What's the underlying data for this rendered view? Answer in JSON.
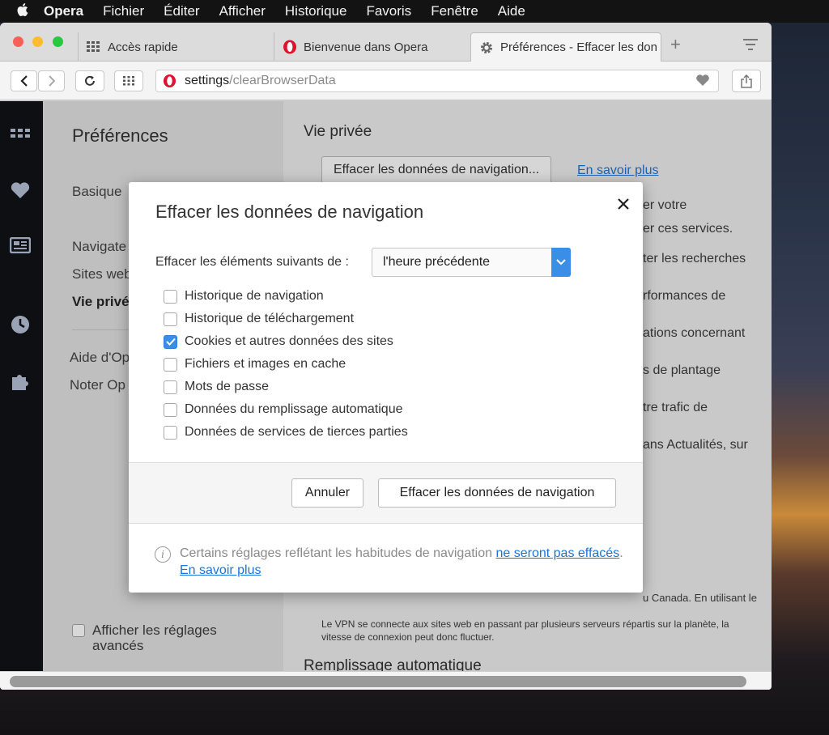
{
  "menubar": {
    "apple": "",
    "app": "Opera",
    "items": [
      "Fichier",
      "Éditer",
      "Afficher",
      "Historique",
      "Favoris",
      "Fenêtre",
      "Aide"
    ]
  },
  "tabs": [
    {
      "label": "Accès rapide",
      "icon": "speed-dial-icon"
    },
    {
      "label": "Bienvenue dans Opera",
      "icon": "opera-logo-icon"
    },
    {
      "label": "Préférences - Effacer les don",
      "icon": "gear-icon",
      "active": true
    }
  ],
  "newtab": "+",
  "address": {
    "host": "settings",
    "path": "/clearBrowserData"
  },
  "prefs": {
    "title": "Préférences",
    "nav": [
      "Basique",
      "Navigate",
      "Sites web",
      "Vie privé",
      "Aide d'Op",
      "Noter Op"
    ],
    "advanced": "Afficher les réglages avancés"
  },
  "content": {
    "heading": "Vie privée",
    "clear_button": "Effacer les données de navigation...",
    "learn_more": "En savoir plus",
    "fragments": [
      "er votre",
      "er ces services.",
      "ter les recherches",
      "rformances de",
      "ations concernant",
      "s de plantage",
      "tre trafic de",
      "ans Actualités, sur"
    ],
    "vpn_line1": "u Canada. En utilisant le",
    "vpn_text": "Le VPN se connecte aux sites web en passant par plusieurs serveurs répartis sur la planète, la vitesse de connexion peut donc fluctuer.",
    "autofill_heading": "Remplissage automatique"
  },
  "dialog": {
    "title": "Effacer les données de navigation",
    "range_label": "Effacer les éléments suivants de :",
    "range_value": "l'heure précédente",
    "options": [
      {
        "label": "Historique de navigation",
        "checked": false
      },
      {
        "label": "Historique de téléchargement",
        "checked": false
      },
      {
        "label": "Cookies et autres données des sites",
        "checked": true
      },
      {
        "label": "Fichiers et images en cache",
        "checked": false
      },
      {
        "label": "Mots de passe",
        "checked": false
      },
      {
        "label": "Données du remplissage automatique",
        "checked": false
      },
      {
        "label": "Données de services de tierces parties",
        "checked": false
      }
    ],
    "cancel": "Annuler",
    "confirm": "Effacer les données de navigation",
    "notice_prefix": "Certains réglages reflétant les habitudes de navigation",
    "notice_link": "ne seront pas effacés",
    "notice_sep": ".",
    "notice_link2": "En savoir plus",
    "accent": "#3b8ee8"
  }
}
